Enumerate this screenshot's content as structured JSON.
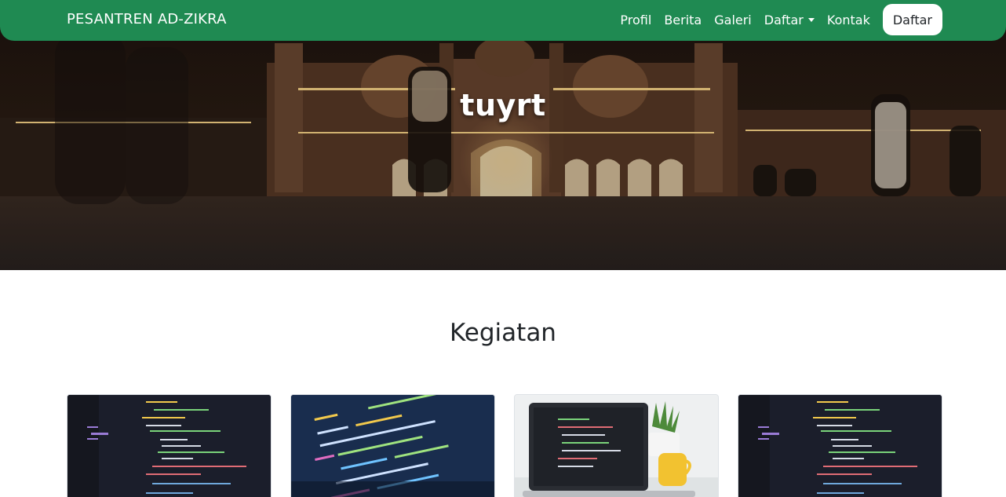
{
  "navbar": {
    "brand": "PESANTREN AD-ZIKRA",
    "links": [
      "Profil",
      "Berita",
      "Galeri",
      "Daftar",
      "Kontak"
    ],
    "cta": "Daftar",
    "color": "#1f8a52"
  },
  "hero": {
    "title": "tuyrt"
  },
  "section": {
    "title": "Kegiatan"
  },
  "cards": [
    {
      "image": "code-editor-screenshot"
    },
    {
      "image": "code-on-laptop-screen"
    },
    {
      "image": "laptop-with-plant-and-mug"
    },
    {
      "image": "code-editor-screenshot"
    }
  ]
}
